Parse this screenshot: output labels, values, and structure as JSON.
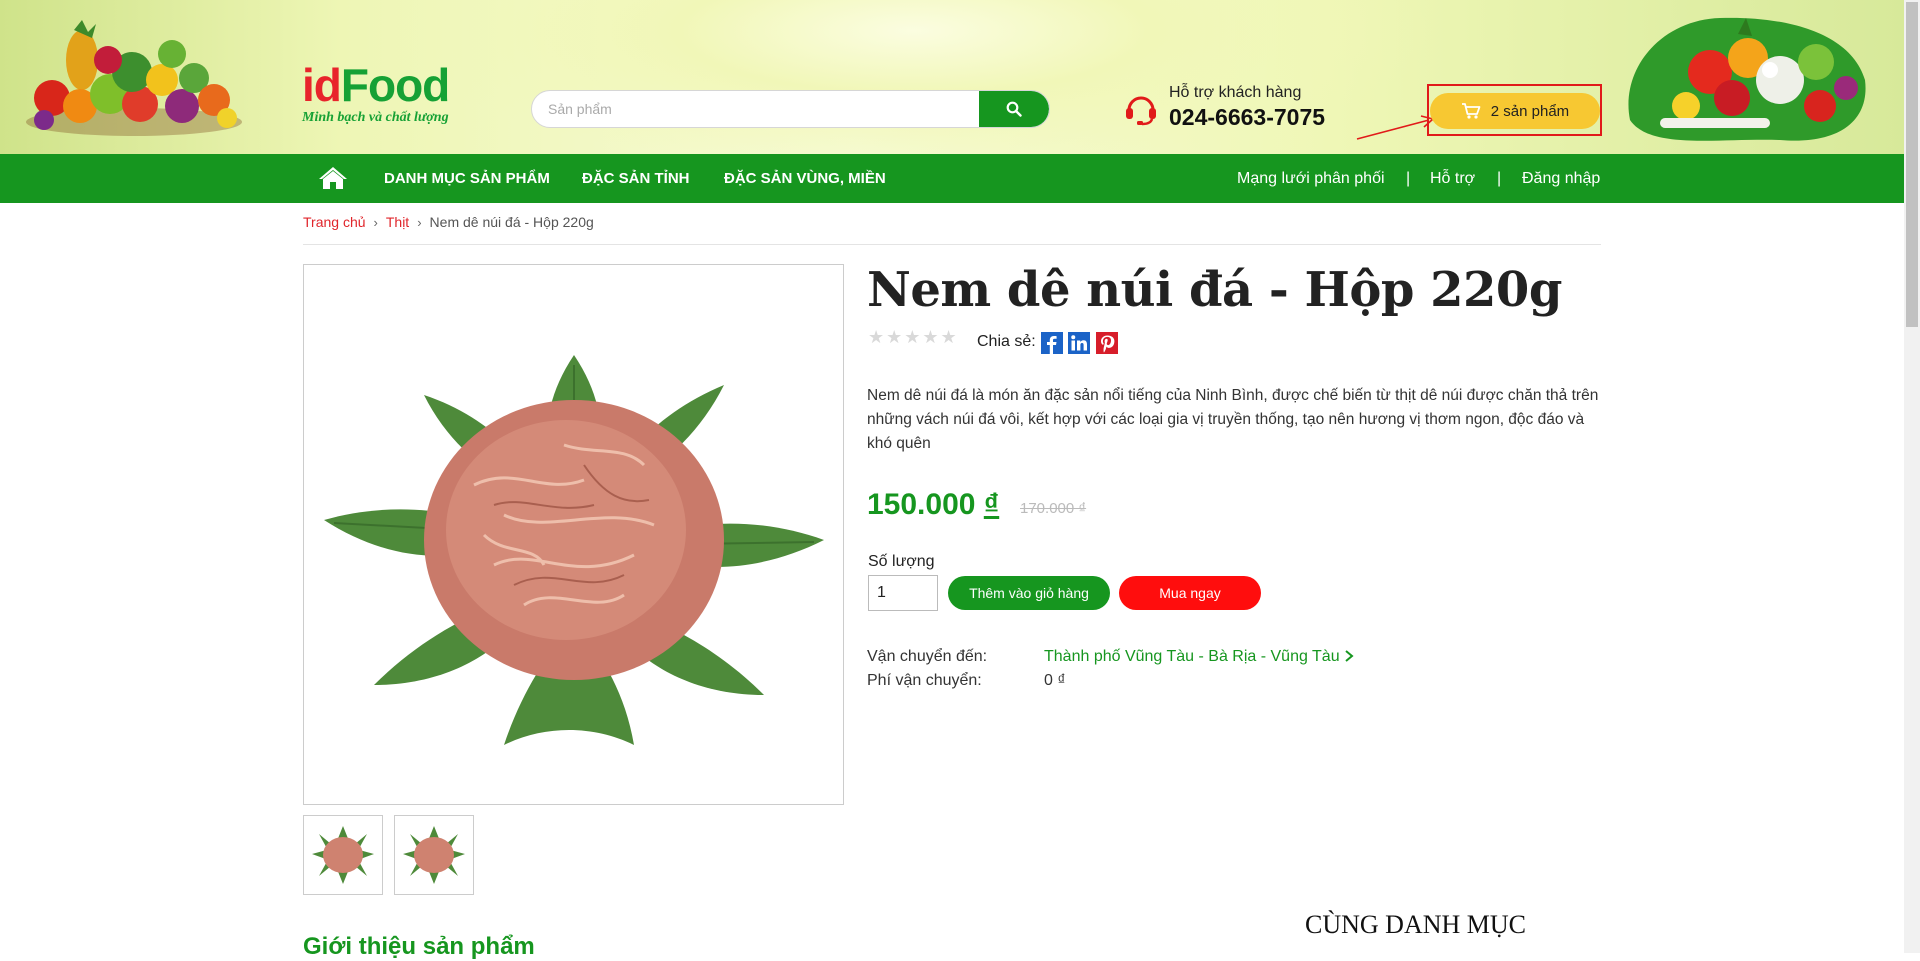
{
  "header": {
    "logo": {
      "part_red": "id",
      "part_green": "Food",
      "tagline": "Minh bạch và chất lượng"
    },
    "search": {
      "placeholder": "Sản phẩm",
      "value": ""
    },
    "support": {
      "label": "Hỗ trợ khách hàng",
      "phone": "024-6663-7075"
    },
    "cart": {
      "label": "2 sản phẩm"
    }
  },
  "nav": {
    "items": [
      "DANH MỤC SẢN PHẨM",
      "ĐẶC SẢN TỈNH",
      "ĐẶC SẢN VÙNG, MIỀN"
    ],
    "right": [
      "Mạng lưới phân phối",
      "Hỗ trợ",
      "Đăng nhập"
    ],
    "separator": "|"
  },
  "breadcrumb": {
    "home": "Trang chủ",
    "category": "Thịt",
    "current": "Nem dê núi đá - Hộp 220g",
    "sep": "›"
  },
  "product": {
    "title": "Nem dê núi đá - Hộp 220g",
    "rating": 0,
    "stars": "★★★★★",
    "share_label": "Chia sẻ:",
    "description": "Nem dê núi đá là món ăn đặc sản nổi tiếng của Ninh Bình, được chế biến từ thịt dê núi được chăn thả trên những vách núi đá vôi, kết hợp với các loại gia vị truyền thống, tạo nên hương vị thơm ngon, độc đáo và khó quên",
    "price": "150.000",
    "currency": "₫",
    "old_price": "170.000 ₫",
    "quantity_label": "Số lượng",
    "quantity": "1",
    "add_to_cart": "Thêm vào giỏ hàng",
    "buy_now": "Mua ngay",
    "shipping_to_label": "Vận chuyển đến:",
    "shipping_to_value": "Thành phố Vũng Tàu - Bà Rịa - Vũng Tàu",
    "shipping_fee_label": "Phí vận chuyển:",
    "shipping_fee_value": "0 ₫"
  },
  "sections": {
    "intro": "Giới thiệu sản phẩm",
    "same_category": "CÙNG DANH MỤC"
  },
  "colors": {
    "brand_green": "#16961f",
    "brand_red": "#e8242b",
    "cart_yellow": "#f7c832",
    "buy_red": "#ff0d0d"
  },
  "icons": [
    "home-icon",
    "search-icon",
    "headset-icon",
    "cart-icon",
    "facebook-icon",
    "linkedin-icon",
    "pinterest-icon",
    "chevron-right-icon"
  ]
}
